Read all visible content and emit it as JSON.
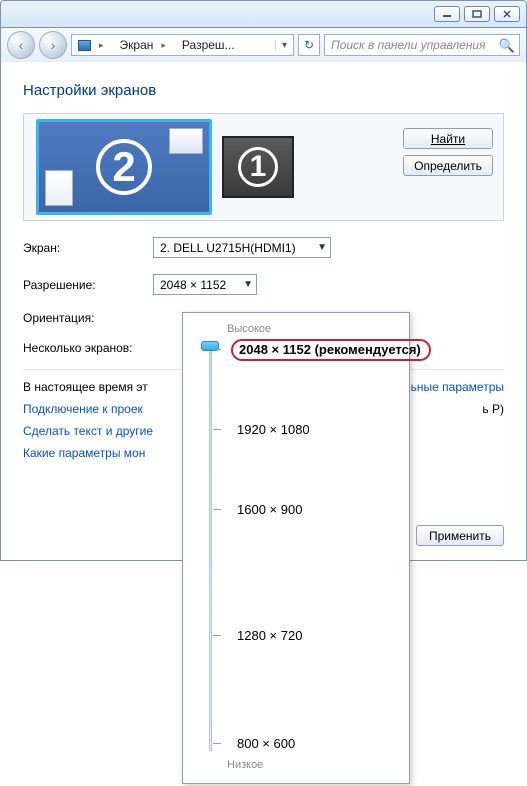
{
  "breadcrumb": {
    "item1": "Экран",
    "item2": "Разреш..."
  },
  "search": {
    "placeholder": "Поиск в панели управления"
  },
  "page": {
    "title": "Настройки экранов"
  },
  "monitors": {
    "primary_number": "2",
    "secondary_number": "1"
  },
  "buttons": {
    "find": "Найти",
    "identify": "Определить",
    "apply": "Применить"
  },
  "labels": {
    "screen": "Экран:",
    "resolution": "Разрешение:",
    "orientation": "Ориентация:",
    "multiple": "Несколько экранов:",
    "currently": "В настоящее время эт",
    "addl_params": "тельные параметры",
    "addl_params_suffix": "ь Р)"
  },
  "combos": {
    "screen_value": "2. DELL U2715H(HDMI1)",
    "resolution_value": "2048 × 1152"
  },
  "links": {
    "projector": "Подключение к проек",
    "textsize": "Сделать текст и другие",
    "monparams": "Какие параметры мон"
  },
  "popup": {
    "high": "Высокое",
    "low": "Низкое",
    "recommended_suffix": "(рекомендуется)",
    "resolutions": {
      "r0": "2048 × 1152",
      "r1": "1920 × 1080",
      "r2": "1600 × 900",
      "r3": "1280 × 720",
      "r4": "800 × 600"
    }
  }
}
